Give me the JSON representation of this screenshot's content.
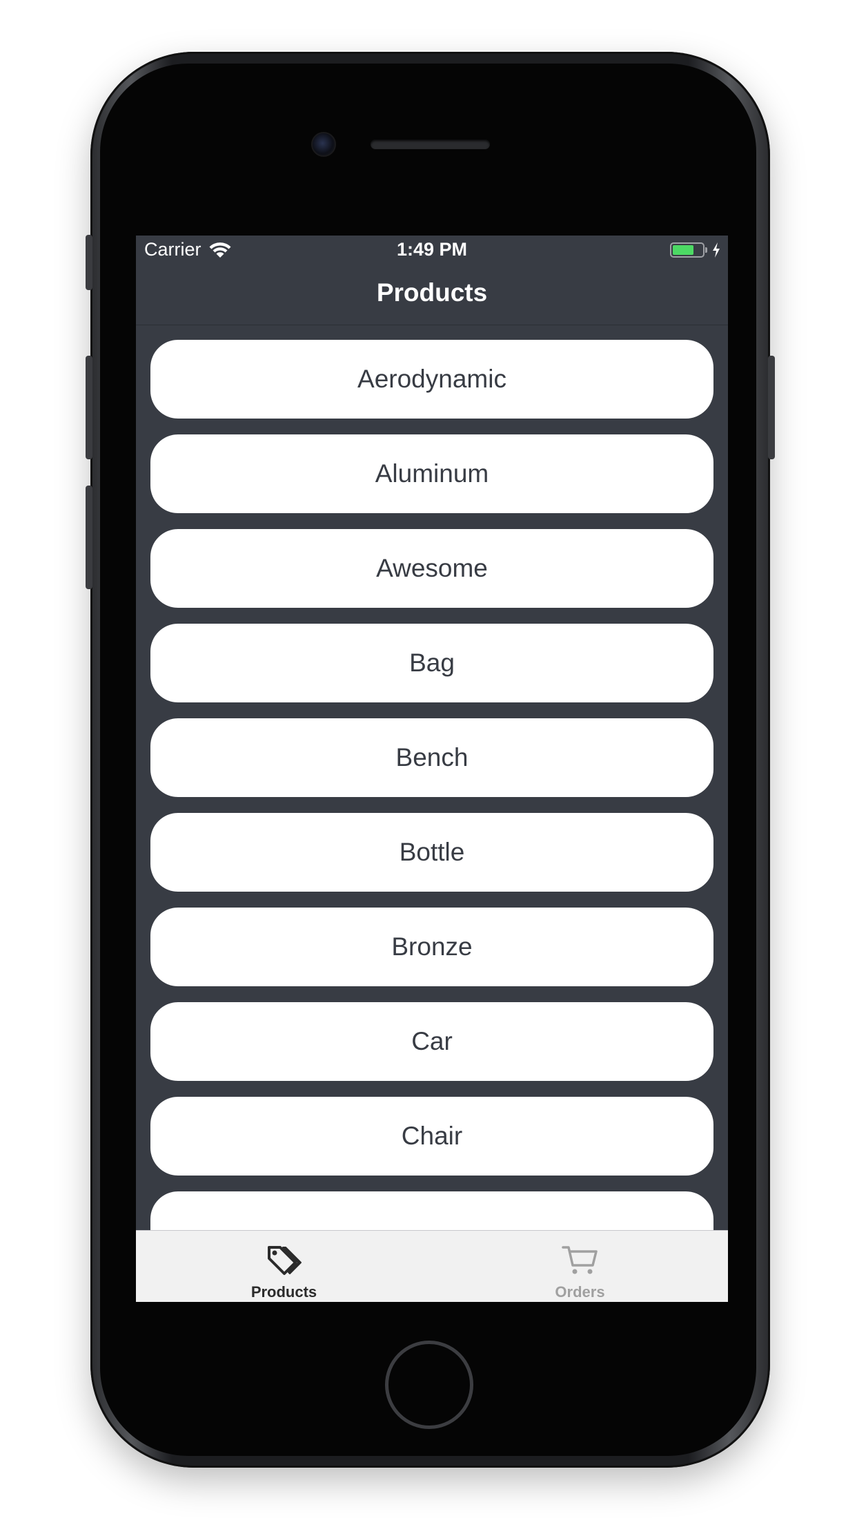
{
  "status_bar": {
    "carrier": "Carrier",
    "time": "1:49 PM",
    "battery_color": "#4cd964"
  },
  "nav": {
    "title": "Products"
  },
  "products": [
    "Aerodynamic",
    "Aluminum",
    "Awesome",
    "Bag",
    "Bench",
    "Bottle",
    "Bronze",
    "Car",
    "Chair",
    ""
  ],
  "tab_bar": {
    "tabs": [
      {
        "label": "Products",
        "icon": "tag-icon",
        "selected": true
      },
      {
        "label": "Orders",
        "icon": "cart-icon",
        "selected": false
      }
    ],
    "active_color": "#2b2b2b",
    "inactive_color": "#a0a0a0"
  },
  "colors": {
    "background": "#383c44",
    "item_background": "#ffffff",
    "item_text": "#383c44"
  }
}
